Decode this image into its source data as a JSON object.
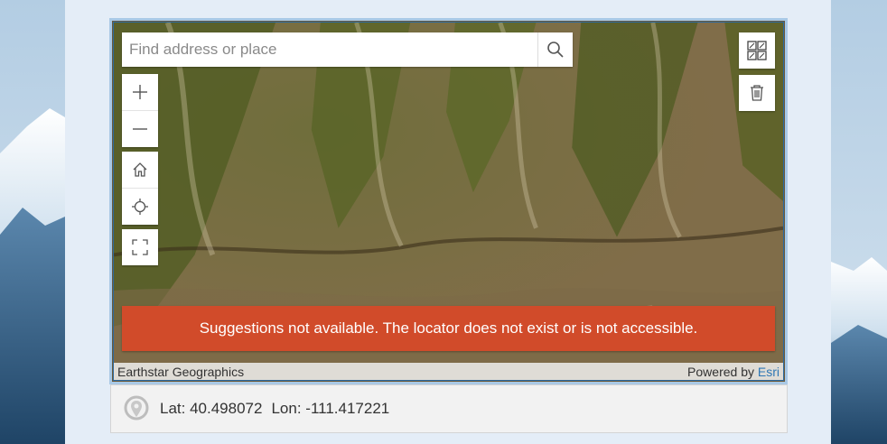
{
  "search": {
    "placeholder": "Find address or place",
    "button_icon": "search-icon"
  },
  "nav_tools": {
    "zoom_in_icon": "plus-icon",
    "zoom_out_icon": "minus-icon",
    "home_icon": "home-icon",
    "locate_icon": "crosshair-icon",
    "fullscreen_icon": "expand-icon"
  },
  "right_tools": {
    "basemap_icon": "basemap-gallery-icon",
    "delete_icon": "trash-icon"
  },
  "error_message": "Suggestions not available. The locator does not exist or is not accessible.",
  "attribution": {
    "left": "Earthstar Geographics",
    "powered_prefix": "Powered by",
    "powered_link": "Esri"
  },
  "coordinates": {
    "lat_label": "Lat:",
    "lat_value": "40.498072",
    "lon_label": "Lon:",
    "lon_value": "-111.417221",
    "icon": "location-pin-icon"
  },
  "colors": {
    "error_bg": "#d14b2a",
    "panel_bg": "#e4edf7",
    "frame_border": "#a9c9e6",
    "link": "#2f78b5"
  }
}
